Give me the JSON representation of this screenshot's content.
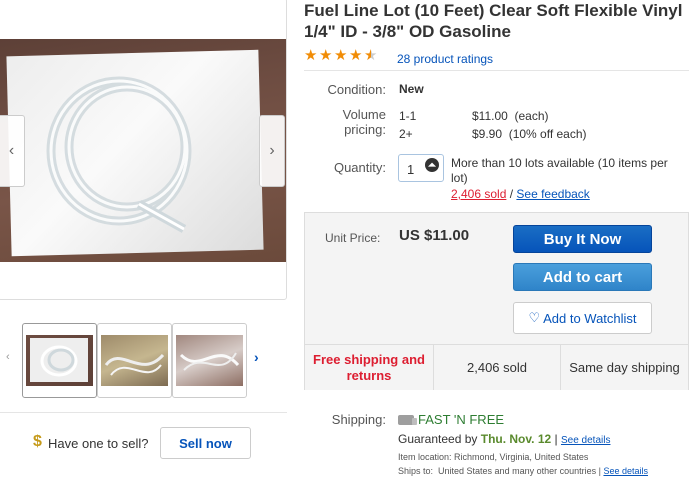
{
  "product": {
    "title": "Fuel Line Lot (10 Feet) Clear Soft Flexible Vinyl 1/4\" ID - 3/8\" OD Gasoline",
    "rating_stars": 4.5,
    "ratings_text": "28 product ratings"
  },
  "gallery": {
    "prev_arrow": "‹",
    "next_arrow": "›",
    "thumb_prev": "‹",
    "thumb_next": "›"
  },
  "condition": {
    "label": "Condition:",
    "value": "New"
  },
  "volume_pricing": {
    "label": "Volume pricing:",
    "tiers": [
      {
        "qty": "1-1",
        "price": "$11.00  (each)"
      },
      {
        "qty": "2+",
        "price": "$9.90  (10% off each)"
      }
    ]
  },
  "quantity": {
    "label": "Quantity:",
    "value": "1",
    "availability": "More than 10 lots available (10 items per lot)",
    "sold": "2,406 sold",
    "separator": " / ",
    "feedback_link": "See feedback"
  },
  "buy_box": {
    "unit_price_label": "Unit Price:",
    "unit_price": "US $11.00",
    "buy_now": "Buy It Now",
    "add_to_cart": "Add to cart",
    "watchlist": "Add to Watchlist",
    "free_shipping": "Free shipping and returns",
    "sold": "2,406 sold",
    "same_day": "Same day shipping"
  },
  "sell": {
    "question": "Have one to sell?",
    "button": "Sell now"
  },
  "shipping": {
    "label": "Shipping:",
    "fast_free": "FAST 'N FREE",
    "guaranteed_prefix": "Guaranteed by ",
    "guaranteed_date": "Thu. Nov. 12",
    "see_details": "See details",
    "item_location": "Item location:  Richmond, Virginia, United States",
    "ships_to": "Ships to:  United States and many other countries | ",
    "see_details_2": "See details"
  },
  "colors": {
    "link": "#0654ba",
    "buy_now": "#0654ba",
    "star": "#f18c06",
    "free_shipping": "#dd1e31",
    "fast_free": "#2e7d32"
  }
}
